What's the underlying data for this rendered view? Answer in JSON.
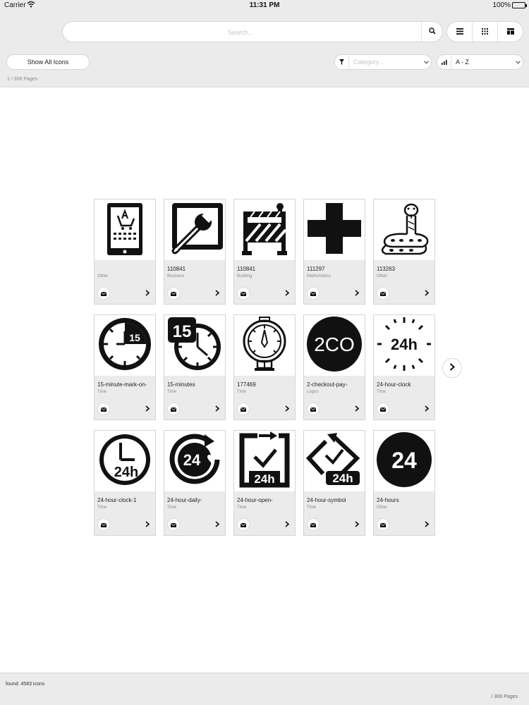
{
  "status": {
    "carrier": "Carrier",
    "time": "11:31 PM",
    "battery": "100%"
  },
  "search": {
    "placeholder": "Search..."
  },
  "toolbar": {
    "show_all_label": "Show All Icons",
    "page_info": "1 / 306 Pages"
  },
  "filters": {
    "category_placeholder": "Category...",
    "sort_value": "A - Z"
  },
  "icons": [
    {
      "name": "",
      "category": "Other"
    },
    {
      "name": "110841",
      "category": "Business"
    },
    {
      "name": "110841",
      "category": "Building"
    },
    {
      "name": "111297",
      "category": "Mathematics"
    },
    {
      "name": "113263",
      "category": "Other"
    },
    {
      "name": "15-minute-mark-on-",
      "category": "Time"
    },
    {
      "name": "15-minutes",
      "category": "Time"
    },
    {
      "name": "177469",
      "category": "Time"
    },
    {
      "name": "2-checkout-pay-",
      "category": "Logos"
    },
    {
      "name": "24-hour-clock",
      "category": "Time"
    },
    {
      "name": "24-hour-clock-1",
      "category": "Time"
    },
    {
      "name": "24-hour-daily-",
      "category": "Time"
    },
    {
      "name": "24-hour-open-",
      "category": "Time"
    },
    {
      "name": "24-hour-symbol",
      "category": "Time"
    },
    {
      "name": "24-hours",
      "category": "Other"
    }
  ],
  "icon_art": {
    "badge_15": "15",
    "label_2co": "2CO",
    "label_24h": "24h",
    "label_24": "24"
  },
  "footer": {
    "found": "found: 4583 icons",
    "pages": "/ 306 Pages"
  }
}
